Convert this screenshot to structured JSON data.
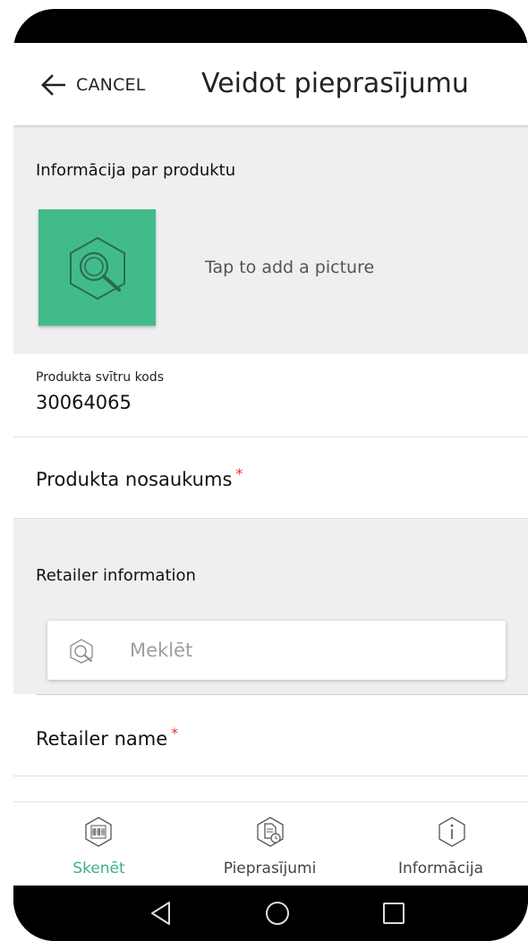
{
  "appbar": {
    "cancel_label": "CANCEL",
    "title": "Veidot pieprasījumu",
    "back_icon": "arrow-left-icon"
  },
  "product_section": {
    "label": "Informācija par produktu",
    "picture_icon": "magnifier-hexagon-icon",
    "picture_color": "#41bb8a",
    "tap_text": "Tap to add a picture"
  },
  "barcode_field": {
    "label": "Produkta svītru kods",
    "value": "30064065"
  },
  "product_name_field": {
    "label": "Produkta nosaukums",
    "required_mark": "*"
  },
  "retailer_section": {
    "label": "Retailer information",
    "search_placeholder": "Meklēt",
    "search_icon": "magnifier-hexagon-icon"
  },
  "retailer_name_field": {
    "label": "Retailer name",
    "required_mark": "*"
  },
  "bottom_nav": {
    "items": [
      {
        "label": "Skenēt",
        "icon": "barcode-scan-icon",
        "active": true
      },
      {
        "label": "Pieprasījumi",
        "icon": "document-clock-icon",
        "active": false
      },
      {
        "label": "Informācija",
        "icon": "info-icon",
        "active": false
      }
    ],
    "active_color": "#3db07f"
  },
  "system_nav": {
    "back": "triangle-back-icon",
    "home": "circle-home-icon",
    "recents": "square-recents-icon"
  }
}
